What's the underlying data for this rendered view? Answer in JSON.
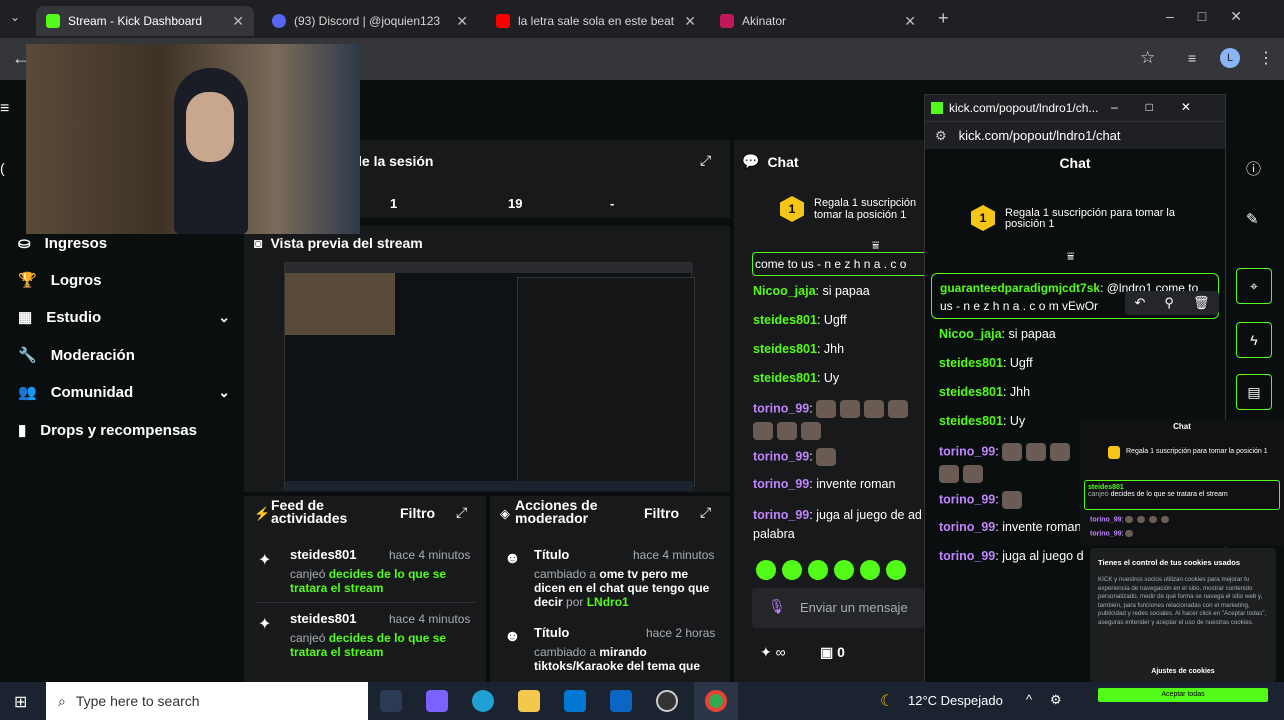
{
  "tabs": [
    {
      "label": "Stream - Kick Dashboard",
      "color": "#53fc18"
    },
    {
      "label": "(93) Discord | @joquien123",
      "color": "#5865f2"
    },
    {
      "label": "la letra sale sola en este beat (n",
      "color": "#ff0000"
    },
    {
      "label": "Akinator",
      "color": "#c2185b"
    }
  ],
  "stats": {
    "a": "1",
    "b": "19",
    "c": "-"
  },
  "session_title": "le la sesión",
  "sidebar": [
    {
      "label": "Ingresos",
      "icon": "coin-icon",
      "chev": false
    },
    {
      "label": "Logros",
      "icon": "trophy-icon",
      "chev": false
    },
    {
      "label": "Estudio",
      "icon": "studio-icon",
      "chev": true
    },
    {
      "label": "Moderación",
      "icon": "wrench-icon",
      "chev": false
    },
    {
      "label": "Comunidad",
      "icon": "users-icon",
      "chev": true
    },
    {
      "label": "Drops y recompensas",
      "icon": "chart-icon",
      "chev": false
    }
  ],
  "preview_title": "Vista previa del stream",
  "activity": {
    "title": "Feed de actividades",
    "filter": "Filtro",
    "items": [
      {
        "user": "steides801",
        "time": "hace 4 minutos",
        "verb": "canjeó",
        "reward": "decides de lo que se tratara el stream"
      },
      {
        "user": "steides801",
        "time": "hace 4 minutos",
        "verb": "canjeó",
        "reward": "decides de lo que se tratara el stream"
      }
    ]
  },
  "modactions": {
    "title": "Acciones de moderador",
    "filter": "Filtro",
    "items": [
      {
        "title": "Título",
        "time": "hace 4 minutos",
        "verb": "cambiado a",
        "value": "ome tv pero me dicen en el chat que tengo que decir",
        "by": "por",
        "mod": "LNdro1"
      },
      {
        "title": "Título",
        "time": "hace 2 horas",
        "verb": "cambiado a",
        "value": "mirando tiktoks/Karaoke del tema que"
      }
    ]
  },
  "chat": {
    "title": "Chat",
    "gift": "Regala 1 suscripción para tomar la posición 1",
    "gift_short": "Regala 1 suscripción tomar la posición 1",
    "pinned": "come to us - n e z h n a . c o",
    "lines": [
      {
        "user": "Nicoo_jaja",
        "msg": "si papaa",
        "color": "green"
      },
      {
        "user": "steides801",
        "msg": "Ugff",
        "color": "green"
      },
      {
        "user": "steides801",
        "msg": "Jhh",
        "color": "green"
      },
      {
        "user": "steides801",
        "msg": "Uy",
        "color": "green"
      },
      {
        "user": "torino_99",
        "msg": "",
        "color": "purple"
      },
      {
        "user": "torino_99",
        "msg": "",
        "color": "purple"
      },
      {
        "user": "torino_99",
        "msg": "invente roman",
        "color": "purple"
      },
      {
        "user": "torino_99",
        "msg": "juga al juego de ad palabra",
        "color": "purple"
      }
    ],
    "input_placeholder": "Enviar un mensaje",
    "infinity": "∞",
    "count": "0"
  },
  "popout": {
    "window_title": "kick.com/popout/lndro1/ch...",
    "url": "kick.com/popout/lndro1/chat",
    "title": "Chat",
    "gift": "Regala 1 suscripción para tomar la posición 1",
    "highlight_user": "guaranteedparadigmjcdt7sk",
    "highlight_msg": "@lndro1 come to us - n e z h n a . c o m vEwOr",
    "lines": [
      {
        "user": "Nicoo_jaja",
        "msg": "si papaa",
        "color": "green"
      },
      {
        "user": "steides801",
        "msg": "Ugff",
        "color": "green"
      },
      {
        "user": "steides801",
        "msg": "Jhh",
        "color": "green"
      },
      {
        "user": "steides801",
        "msg": "Uy",
        "color": "green"
      },
      {
        "user": "torino_99",
        "msg": "",
        "color": "purple"
      },
      {
        "user": "torino_99",
        "msg": "",
        "color": "purple"
      },
      {
        "user": "torino_99",
        "msg": "invente roman",
        "color": "purple"
      },
      {
        "user": "torino_99",
        "msg": "juga al juego d",
        "color": "purple"
      }
    ],
    "mini_chat": "Chat",
    "mini_gift": "Regala 1 suscripción para tomar la posición 1",
    "cookies_title": "Tienes el control de tus cookies usados",
    "cookies_text": "KICK y nuestros socios utilizan cookies para mejorar tu experiencia de navegación en el sitio, mostrar contenido personalizado, medir de qué forma se navega el sitio web y, también, para funciones relacionadas con el marketing, publicidad y redes sociales. Al hacer click en \"Aceptar todas\", aseguras entender y aceptar el uso de nuestras cookies.",
    "cookies_settings": "Ajustes de cookies",
    "cookies_accept": "Aceptar todas"
  },
  "taskbar": {
    "search": "Type here to search",
    "weather": "12°C  Despejado"
  }
}
